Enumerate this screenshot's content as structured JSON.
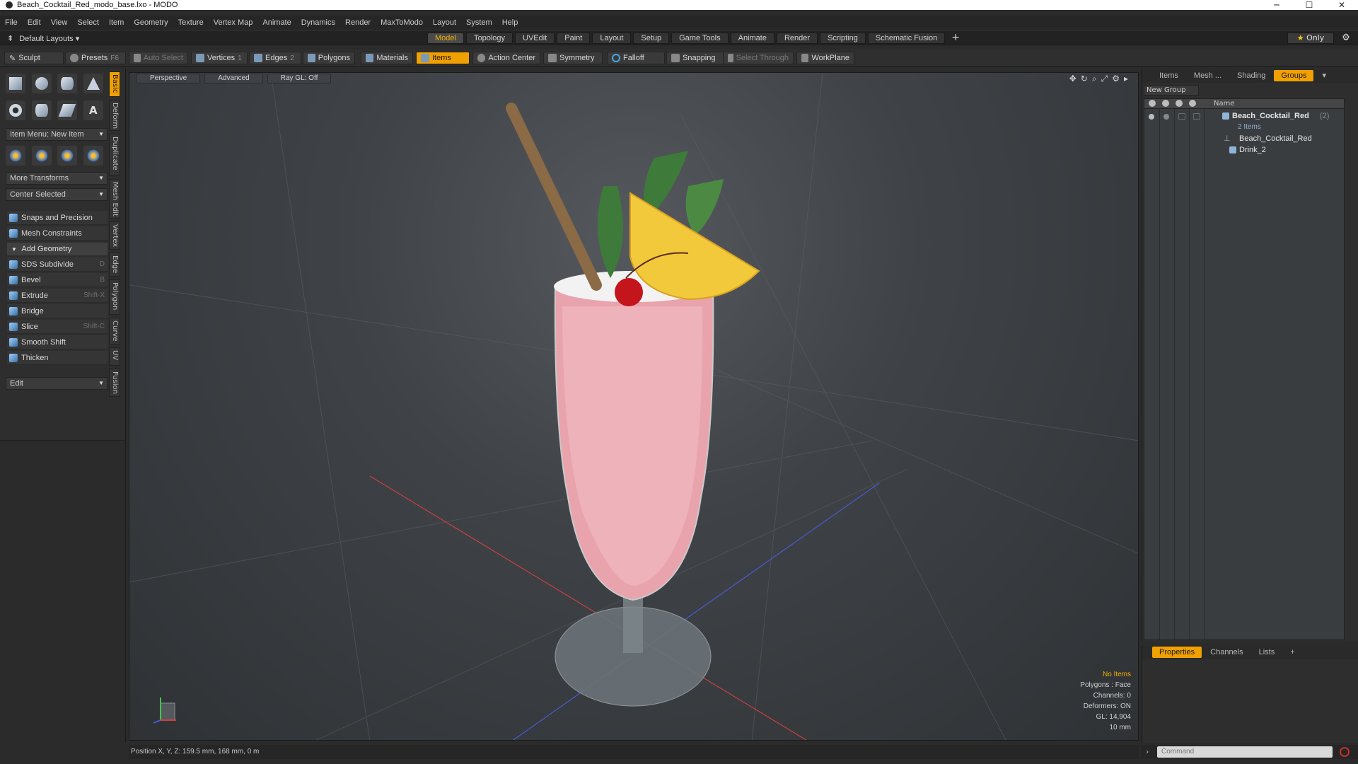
{
  "window": {
    "title": "Beach_Cocktail_Red_modo_base.lxo - MODO",
    "controls": [
      "─",
      "☐",
      "✕"
    ]
  },
  "menubar": [
    "File",
    "Edit",
    "View",
    "Select",
    "Item",
    "Geometry",
    "Texture",
    "Vertex Map",
    "Animate",
    "Dynamics",
    "Render",
    "MaxToModo",
    "Layout",
    "System",
    "Help"
  ],
  "layouts": {
    "label": "Default Layouts ▾"
  },
  "tabs": [
    "Model",
    "Topology",
    "UVEdit",
    "Paint",
    "Layout",
    "Setup",
    "Game Tools",
    "Animate",
    "Render",
    "Scripting",
    "Schematic Fusion"
  ],
  "active_tab": "Model",
  "only_label": "Only",
  "toolbar": {
    "sculpt": "Sculpt",
    "presets": "Presets",
    "presets_key": "F6",
    "auto_select": "Auto Select",
    "vertices": "Vertices",
    "vertices_count": "1",
    "edges": "Edges",
    "edges_count": "2",
    "polygons": "Polygons",
    "materials": "Materials",
    "items": "Items",
    "action_center": "Action Center",
    "symmetry": "Symmetry",
    "falloff": "Falloff",
    "snapping": "Snapping",
    "select_through": "Select Through",
    "workplane": "WorkPlane"
  },
  "toolbox": {
    "item_menu": "Item Menu: New Item",
    "more_transforms": "More Transforms",
    "center_selected": "Center Selected",
    "snaps": "Snaps and Precision",
    "mesh_constraints": "Mesh Constraints",
    "add_geometry": "Add Geometry",
    "tools": [
      {
        "label": "SDS Subdivide",
        "key": "D"
      },
      {
        "label": "Bevel",
        "key": "B"
      },
      {
        "label": "Extrude",
        "key": "Shift-X"
      },
      {
        "label": "Bridge",
        "key": ""
      },
      {
        "label": "Slice",
        "key": "Shift-C"
      },
      {
        "label": "Smooth Shift",
        "key": ""
      },
      {
        "label": "Thicken",
        "key": ""
      }
    ],
    "edit": "Edit"
  },
  "vtabs": [
    "Basic",
    "Deform",
    "Duplicate",
    "Mesh Edit",
    "Vertex",
    "Edge",
    "Polygon",
    "Curve",
    "UV",
    "Fusion"
  ],
  "viewport": {
    "view": "Perspective",
    "mode": "Advanced",
    "raygl": "Ray GL: Off",
    "info": {
      "no_items": "No Items",
      "polygons": "Polygons : Face",
      "channels": "Channels: 0",
      "deformers": "Deformers: ON",
      "gl": "GL: 14,904",
      "scale": "10 mm"
    }
  },
  "status": "Position X, Y, Z:   159.5 mm, 168 mm, 0 m",
  "right_panel": {
    "tabs": [
      "Items",
      "Mesh ...",
      "Shading",
      "Groups"
    ],
    "active_tab": "Groups",
    "new_group": "New Group",
    "name_col": "Name",
    "group": {
      "name": "Beach_Cocktail_Red",
      "count": "(2)",
      "sub": "2 Items"
    },
    "children": [
      "Beach_Cocktail_Red",
      "Drink_2"
    ]
  },
  "lower_panel": {
    "tabs": [
      "Properties",
      "Channels",
      "Lists"
    ],
    "active_tab": "Properties"
  },
  "command_placeholder": "Command",
  "colors": {
    "accent": "#f0a000",
    "panel": "#2e2e2e",
    "viewport": "#3f4347"
  }
}
